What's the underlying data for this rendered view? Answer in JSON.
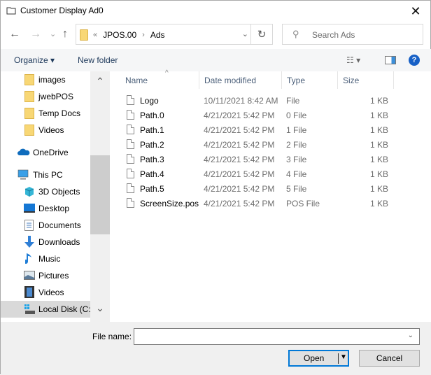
{
  "window": {
    "title": "Customer Display Ad0",
    "close_label": "✕"
  },
  "navbar": {
    "back_icon": "←",
    "forward_icon": "→",
    "recent_icon": "⌄",
    "up_icon": "↑",
    "breadcrumb": {
      "overflow": "«",
      "items": [
        "JPOS.00",
        "Ads"
      ],
      "separator": "›"
    },
    "address_dropdown_icon": "⌄",
    "refresh_icon": "↻",
    "search": {
      "placeholder": "Search Ads",
      "icon": "⚲"
    }
  },
  "toolbar": {
    "organize_label": "Organize ▾",
    "new_folder_label": "New folder",
    "view_icon": "☷ ▾",
    "help_icon": "?"
  },
  "sidebar": {
    "items": [
      {
        "label": "images",
        "icon": "folder-icon"
      },
      {
        "label": "jwebPOS",
        "icon": "folder-icon"
      },
      {
        "label": "Temp Docs",
        "icon": "folder-icon"
      },
      {
        "label": "Videos",
        "icon": "folder-icon"
      },
      {
        "label": "OneDrive",
        "icon": "cloud-icon"
      },
      {
        "label": "This PC",
        "icon": "computer-icon"
      },
      {
        "label": "3D Objects",
        "icon": "cube-icon"
      },
      {
        "label": "Desktop",
        "icon": "desktop-icon"
      },
      {
        "label": "Documents",
        "icon": "document-icon"
      },
      {
        "label": "Downloads",
        "icon": "download-icon"
      },
      {
        "label": "Music",
        "icon": "music-icon"
      },
      {
        "label": "Pictures",
        "icon": "picture-icon"
      },
      {
        "label": "Videos",
        "icon": "film-icon"
      },
      {
        "label": "Local Disk (C:)",
        "icon": "drive-icon",
        "selected": true
      }
    ],
    "scroll_up_icon": "⌃",
    "scroll_down_icon": "⌄"
  },
  "file_list": {
    "columns": [
      "Name",
      "Date modified",
      "Type",
      "Size"
    ],
    "sort_indicator": "^",
    "rows": [
      {
        "name": "Logo",
        "date": "10/11/2021 8:42 AM",
        "type": "File",
        "size": "1 KB"
      },
      {
        "name": "Path.0",
        "date": "4/21/2021 5:42 PM",
        "type": "0 File",
        "size": "1 KB"
      },
      {
        "name": "Path.1",
        "date": "4/21/2021 5:42 PM",
        "type": "1 File",
        "size": "1 KB"
      },
      {
        "name": "Path.2",
        "date": "4/21/2021 5:42 PM",
        "type": "2 File",
        "size": "1 KB"
      },
      {
        "name": "Path.3",
        "date": "4/21/2021 5:42 PM",
        "type": "3 File",
        "size": "1 KB"
      },
      {
        "name": "Path.4",
        "date": "4/21/2021 5:42 PM",
        "type": "4 File",
        "size": "1 KB"
      },
      {
        "name": "Path.5",
        "date": "4/21/2021 5:42 PM",
        "type": "5 File",
        "size": "1 KB"
      },
      {
        "name": "ScreenSize.pos",
        "date": "4/21/2021 5:42 PM",
        "type": "POS File",
        "size": "1 KB"
      }
    ]
  },
  "footer": {
    "file_name_label": "File name:",
    "file_name_value": "",
    "dropdown_icon": "⌄",
    "open_label": "Open",
    "open_dropdown_icon": "▼",
    "cancel_label": "Cancel"
  }
}
